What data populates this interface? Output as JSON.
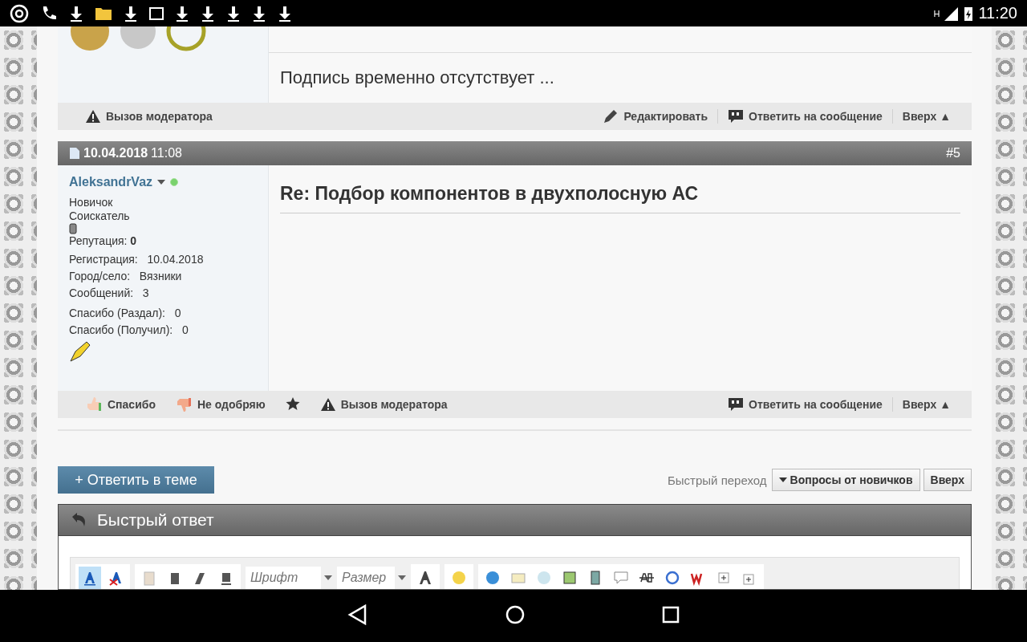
{
  "status_bar": {
    "network": "H",
    "time": "11:20"
  },
  "previous_post": {
    "signature": "Подпись временно отсутствует ...",
    "footer_left": [
      {
        "kind": "report",
        "label": "Вызов модератора"
      }
    ],
    "footer_right": [
      {
        "kind": "edit",
        "label": "Редактировать"
      },
      {
        "kind": "reply",
        "label": "Ответить на сообщение"
      },
      {
        "kind": "top",
        "label": "Вверх ▲"
      }
    ]
  },
  "post": {
    "date": "10.04.2018",
    "time": "11:08",
    "number": "#5",
    "username": "AleksandrVaz",
    "online": true,
    "rank": "Новичок",
    "user_title": "Соискатель",
    "reputation_label": "Репутация:",
    "reputation": "0",
    "info": [
      {
        "label": "Регистрация:",
        "value": "10.04.2018"
      },
      {
        "label": "Город/село:",
        "value": "Вязники"
      },
      {
        "label": "Сообщений:",
        "value": "3"
      }
    ],
    "thanks": [
      {
        "label": "Спасибо (Раздал):",
        "value": "0"
      },
      {
        "label": "Спасибо (Получил):",
        "value": "0"
      }
    ],
    "subject": "Re: Подбор компонентов в двухполосную АС",
    "footer_left": [
      {
        "kind": "thanks",
        "label": "Спасибо"
      },
      {
        "kind": "dislike",
        "label": "Не одобряю"
      },
      {
        "kind": "star"
      },
      {
        "kind": "report",
        "label": "Вызов модератора"
      }
    ],
    "footer_right": [
      {
        "kind": "reply",
        "label": "Ответить на сообщение"
      },
      {
        "kind": "top",
        "label": "Вверх ▲"
      }
    ]
  },
  "reply_button": "+ Ответить в теме",
  "quick_nav": {
    "label": "Быстрый переход",
    "value": "Вопросы от новичков",
    "button": "Вверх"
  },
  "quick_reply": {
    "title": "Быстрый ответ",
    "font_placeholder": "Шрифт",
    "size_placeholder": "Размер"
  }
}
